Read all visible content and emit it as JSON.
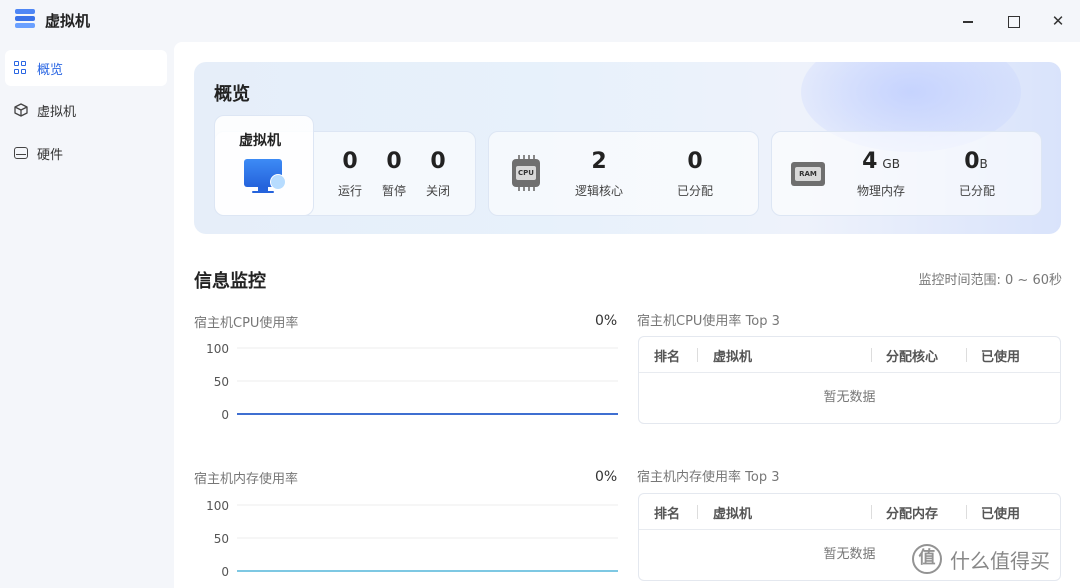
{
  "window": {
    "title": "虚拟机",
    "close_glyph": "✕"
  },
  "sidebar": {
    "items": [
      {
        "label": "概览",
        "icon": "grid-icon",
        "active": true
      },
      {
        "label": "虚拟机",
        "icon": "cube-icon"
      },
      {
        "label": "硬件",
        "icon": "disk-icon"
      }
    ]
  },
  "overview": {
    "title": "概览",
    "vm": {
      "label": "虚拟机",
      "running": "0",
      "running_label": "运行",
      "paused": "0",
      "paused_label": "暂停",
      "closed": "0",
      "closed_label": "关闭"
    },
    "cpu": {
      "chip_text": "CPU",
      "cores": "2",
      "cores_label": "逻辑核心",
      "allocated": "0",
      "allocated_label": "已分配"
    },
    "ram": {
      "chip_text": "RAM",
      "physical": "4",
      "physical_unit": "GB",
      "physical_label": "物理内存",
      "allocated": "0",
      "allocated_unit": "B",
      "allocated_label": "已分配"
    }
  },
  "monitor": {
    "title": "信息监控",
    "range": "监控时间范围: 0 ~ 60秒",
    "cpu_chart": {
      "title": "宿主机CPU使用率",
      "percent": "0%",
      "ticks": [
        "100",
        "50",
        "0"
      ]
    },
    "mem_chart": {
      "title": "宿主机内存使用率",
      "percent": "0%",
      "ticks": [
        "100",
        "50",
        "0"
      ]
    },
    "cpu_table": {
      "title": "宿主机CPU使用率 Top 3",
      "headers": [
        "排名",
        "虚拟机",
        "分配核心",
        "已使用"
      ],
      "empty": "暂无数据"
    },
    "mem_table": {
      "title": "宿主机内存使用率 Top 3",
      "headers": [
        "排名",
        "虚拟机",
        "分配内存",
        "已使用"
      ],
      "empty": "暂无数据"
    }
  },
  "chart_data": [
    {
      "type": "line",
      "title": "宿主机CPU使用率",
      "ylim": [
        0,
        100
      ],
      "yticks": [
        0,
        50,
        100
      ],
      "series": [
        {
          "values": [
            0,
            0
          ]
        }
      ],
      "color": "#3f6fd1"
    },
    {
      "type": "line",
      "title": "宿主机内存使用率",
      "ylim": [
        0,
        100
      ],
      "yticks": [
        0,
        50,
        100
      ],
      "series": [
        {
          "values": [
            0,
            0
          ]
        }
      ],
      "color": "#7ec8e3"
    }
  ],
  "watermark": {
    "logo": "值",
    "text": "什么值得买"
  }
}
